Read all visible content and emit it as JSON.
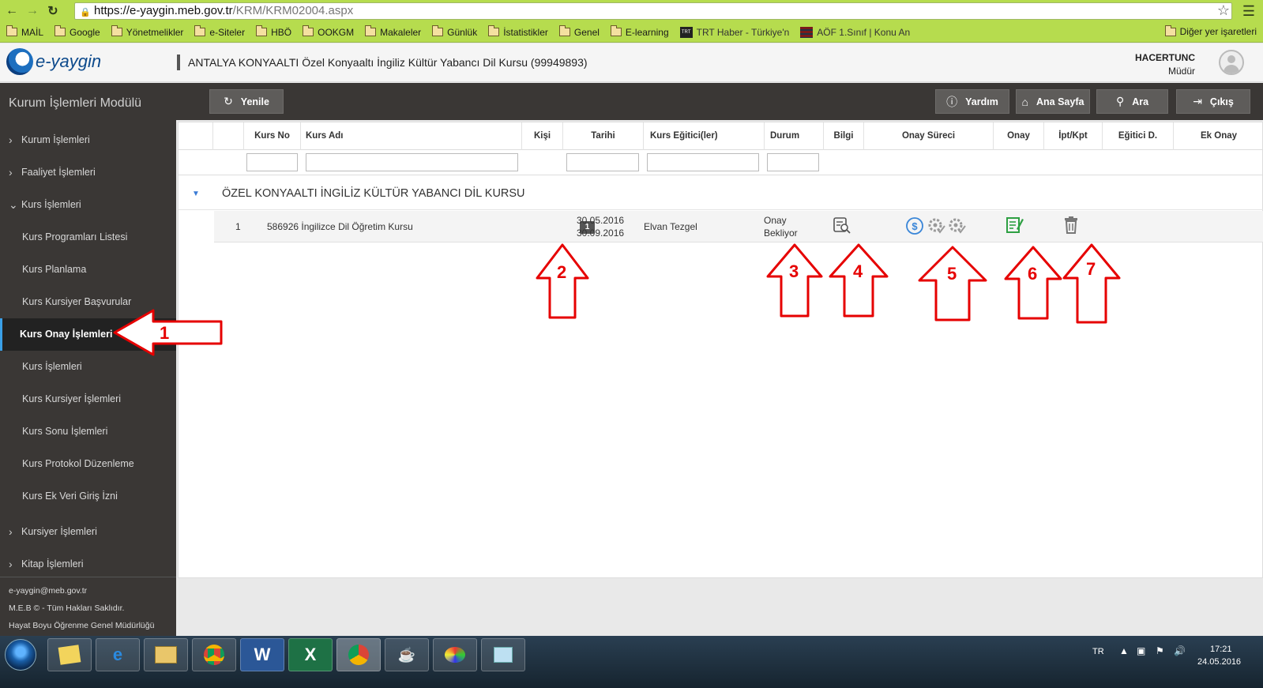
{
  "browser": {
    "url_host": "https://e-yaygin.meb.gov.tr",
    "url_path": "/KRM/KRM02004.aspx",
    "bookmarks": [
      "MAİL",
      "Google",
      "Yönetmelikler",
      "e-Siteler",
      "HBÖ",
      "OOKGM",
      "Makaleler",
      "Günlük",
      "İstatistikler",
      "Genel",
      "E-learning"
    ],
    "bookmark_trt": "TRT Haber - Türkiye'n",
    "bookmark_aof": "AÖF 1.Sınıf | Konu An",
    "bookmark_other": "Diğer yer işaretleri"
  },
  "header": {
    "logo_text": "e-yaygin",
    "institution": "ANTALYA KONYAALTI Özel Konyaaltı İngiliz Kültür Yabancı Dil Kursu (99949893)",
    "user_name": "HACERTUNC",
    "user_role": "Müdür"
  },
  "sidebar": {
    "module_title": "Kurum İşlemleri Modülü",
    "items": [
      {
        "label": "Kurum İşlemleri"
      },
      {
        "label": "Faaliyet İşlemleri"
      },
      {
        "label": "Kurs İşlemleri"
      }
    ],
    "sub_items": [
      {
        "label": "Kurs Programları Listesi"
      },
      {
        "label": "Kurs Planlama"
      },
      {
        "label": "Kurs Kursiyer Başvurular"
      },
      {
        "label": "Kurs Onay İşlemleri"
      },
      {
        "label": "Kurs İşlemleri"
      },
      {
        "label": "Kurs Kursiyer İşlemleri"
      },
      {
        "label": "Kurs Sonu İşlemleri"
      },
      {
        "label": "Kurs Protokol Düzenleme"
      },
      {
        "label": "Kurs Ek Veri Giriş İzni"
      }
    ],
    "bottom_items": [
      {
        "label": "Kursiyer İşlemleri"
      },
      {
        "label": "Kitap İşlemleri"
      }
    ],
    "footer": {
      "email": "e-yaygin@meb.gov.tr",
      "copyright": "M.E.B © - Tüm Hakları Saklıdır.",
      "org": "Hayat Boyu Öğrenme Genel Müdürlüğü"
    }
  },
  "toolbar": {
    "refresh_label": "Yenile",
    "help_label": "Yardım",
    "home_label": "Ana Sayfa",
    "search_label": "Ara",
    "logout_label": "Çıkış"
  },
  "grid": {
    "columns": {
      "kurs_no": "Kurs No",
      "kurs_adi": "Kurs Adı",
      "kisi": "Kişi",
      "tarihi": "Tarihi",
      "egitici": "Kurs Eğitici(ler)",
      "durum": "Durum",
      "bilgi": "Bilgi",
      "onay_sureci": "Onay Süreci",
      "onay": "Onay",
      "ipt_kpt": "İpt/Kpt",
      "egitici_d": "Eğitici D.",
      "ek_onay": "Ek Onay"
    },
    "group_title": "ÖZEL KONYAALTI İNGİLİZ KÜLTÜR YABANCI DİL KURSU",
    "rows": [
      {
        "index": "1",
        "kurs_no_adi": "586926 İngilizce Dil Öğretim Kursu",
        "kisi": "1",
        "start_date": "30.05.2016",
        "end_date": "30.09.2016",
        "egitici": "Elvan Tezgel",
        "durum_line1": "Onay",
        "durum_line2": "Bekliyor"
      }
    ]
  },
  "annotations": {
    "arrow_1": "1",
    "arrow_2": "2",
    "arrow_3": "3",
    "arrow_4": "4",
    "arrow_5": "5",
    "arrow_6": "6",
    "arrow_7": "7",
    "color": "#e60000"
  },
  "taskbar": {
    "lang": "TR",
    "time": "17:21",
    "date": "24.05.2016"
  }
}
